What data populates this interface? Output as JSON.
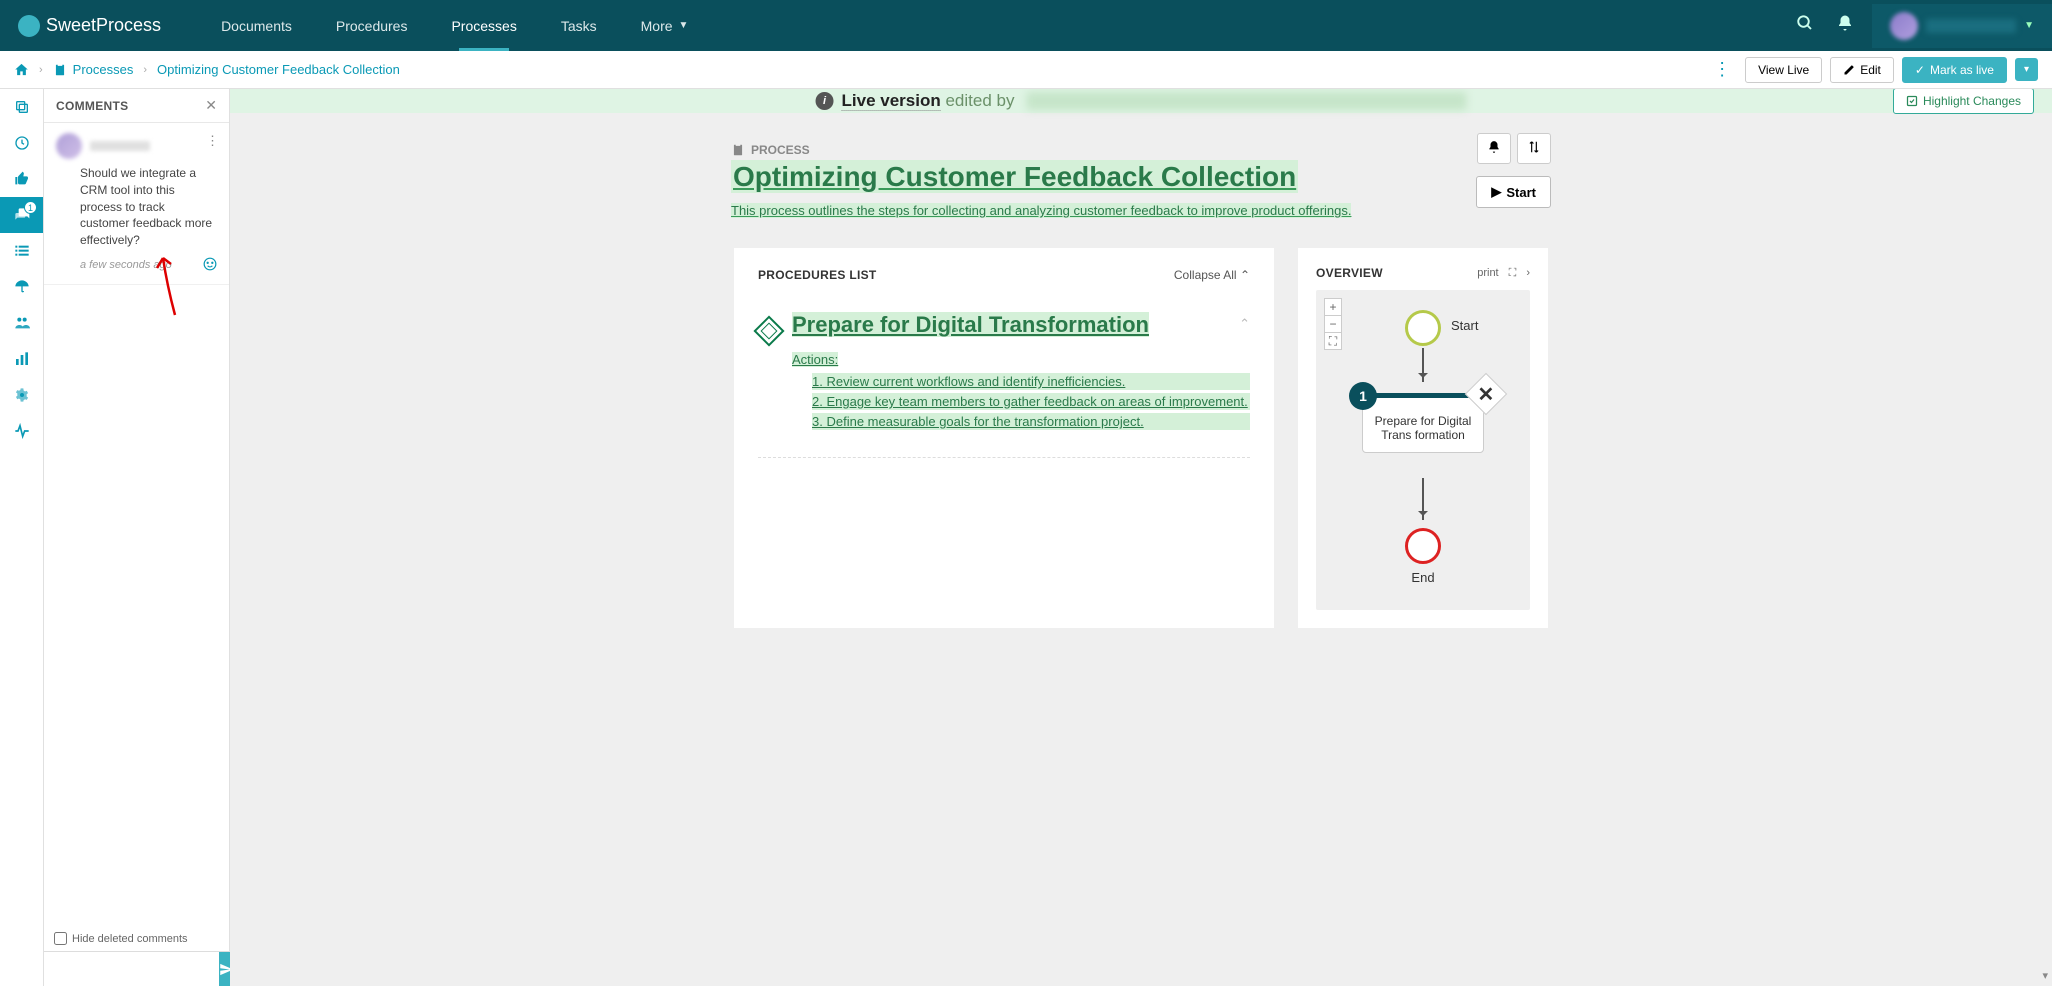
{
  "brand": {
    "name": "SweetProcess"
  },
  "topnav": {
    "items": [
      "Documents",
      "Procedures",
      "Processes",
      "Tasks",
      "More"
    ],
    "active_index": 2
  },
  "breadcrumb": {
    "home_icon": "home",
    "items": [
      {
        "icon": "clipboard",
        "label": "Processes"
      },
      {
        "label": "Optimizing Customer Feedback Collection"
      }
    ],
    "actions": {
      "view_live": "View Live",
      "edit": "Edit",
      "mark_live": "Mark as live"
    }
  },
  "banner": {
    "prefix": "Live version",
    "suffix": "edited by",
    "highlight_btn": "Highlight Changes"
  },
  "leftrail": {
    "items": [
      {
        "name": "copy-icon"
      },
      {
        "name": "clock-icon"
      },
      {
        "name": "thumbs-up-icon"
      },
      {
        "name": "comments-icon",
        "active": true,
        "badge": "1"
      },
      {
        "name": "list-icon"
      },
      {
        "name": "umbrella-icon"
      },
      {
        "name": "people-icon"
      },
      {
        "name": "bar-chart-icon"
      },
      {
        "name": "gear-icon"
      },
      {
        "name": "activity-icon"
      }
    ]
  },
  "comments": {
    "title": "COMMENTS",
    "items": [
      {
        "body": "Should we integrate a CRM tool into this process to track customer feedback more effectively?",
        "time": "a few seconds ago"
      }
    ],
    "hide_deleted": "Hide deleted comments"
  },
  "process": {
    "label": "PROCESS",
    "title": "Optimizing Customer Feedback Collection",
    "description": "This process outlines the steps for collecting and analyzing customer feedback to improve product offerings.",
    "start_btn": "Start"
  },
  "procedures": {
    "title": "PROCEDURES LIST",
    "collapse_all": "Collapse All",
    "items": [
      {
        "title": "Prepare for Digital Transformation",
        "actions_label": "Actions:",
        "actions": [
          "Review current workflows and identify inefficiencies.",
          "Engage key team members to gather feedback on areas of improvement.",
          "Define measurable goals for the transformation project."
        ]
      }
    ]
  },
  "overview": {
    "title": "OVERVIEW",
    "print": "print",
    "start_label": "Start",
    "node_badge": "1",
    "node_title": "Prepare for Digital Trans formation",
    "end_label": "End"
  }
}
